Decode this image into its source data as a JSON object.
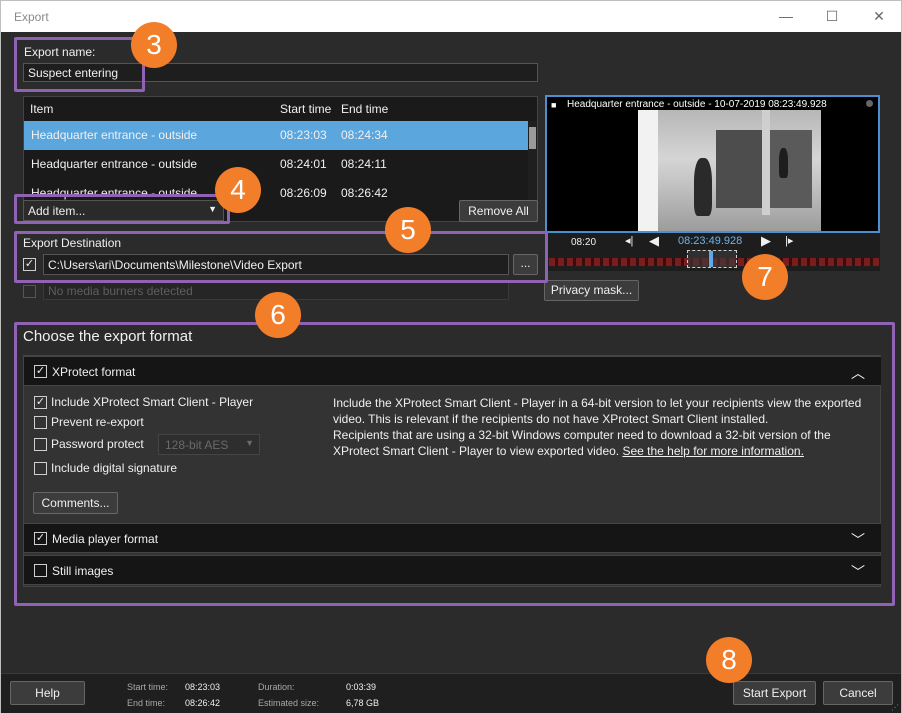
{
  "window": {
    "title": "Export",
    "minimize_glyph": "—",
    "maximize_glyph": "☐",
    "close_glyph": "✕"
  },
  "export_name": {
    "label": "Export name:",
    "value": "Suspect entering"
  },
  "item_list": {
    "headers": {
      "item": "Item",
      "start": "Start time",
      "end": "End time"
    },
    "rows": [
      {
        "item": "Headquarter entrance - outside",
        "start": "08:23:03",
        "end": "08:24:34"
      },
      {
        "item": "Headquarter entrance - outside",
        "start": "08:24:01",
        "end": "08:24:11"
      },
      {
        "item": "Headquarter entrance - outside",
        "start": "08:26:09",
        "end": "08:26:42"
      }
    ],
    "add_item_label": "Add item...",
    "remove_all_label": "Remove All"
  },
  "destination": {
    "label": "Export Destination",
    "path": "C:\\Users\\ari\\Documents\\Milestone\\Video Export",
    "browse_label": "...",
    "media_burners": "No media burners detected"
  },
  "preview": {
    "caption": "Headquarter entrance - outside - 10-07-2019 08:23:49.928",
    "tick_label": "08:20",
    "current_time": "08:23:49.928",
    "privacy_mask_label": "Privacy mask..."
  },
  "format": {
    "title": "Choose the export format",
    "xprotect": {
      "label": "XProtect format",
      "include_player": "Include XProtect Smart Client - Player",
      "prevent_reexport": "Prevent re-export",
      "password_protect": "Password protect",
      "encryption": "128-bit AES",
      "digital_signature": "Include digital signature",
      "comments_label": "Comments...",
      "description_1": "Include the XProtect Smart Client - Player in a 64-bit version to let your recipients view the exported video. This is relevant if the recipients do not have XProtect Smart Client installed.",
      "description_2": "Recipients that are using a 32-bit Windows computer need to download a 32-bit version of the XProtect Smart Client - Player to view exported video.",
      "help_link": "See the help for more information."
    },
    "media_player": {
      "label": "Media player format"
    },
    "still_images": {
      "label": "Still images"
    }
  },
  "footer": {
    "help_label": "Help",
    "start_time_key": "Start time:",
    "start_time_val": "08:23:03",
    "end_time_key": "End time:",
    "end_time_val": "08:26:42",
    "duration_key": "Duration:",
    "duration_val": "0:03:39",
    "size_key": "Estimated size:",
    "size_val": "6,78 GB",
    "start_export_label": "Start Export",
    "cancel_label": "Cancel"
  },
  "badges": {
    "b3": "3",
    "b4": "4",
    "b5": "5",
    "b6": "6",
    "b7": "7",
    "b8": "8"
  },
  "colors": {
    "accent": "#8f62b3",
    "badge": "#f27e2a",
    "selection": "#5aa6dd"
  }
}
